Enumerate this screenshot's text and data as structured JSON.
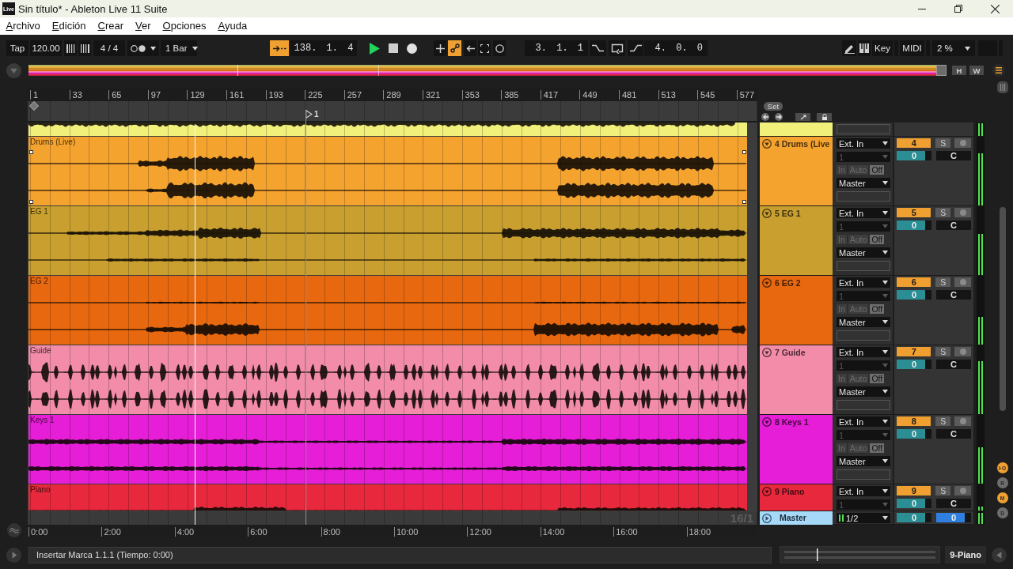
{
  "window": {
    "app_badge": "Live",
    "title": "Sin título* - Ableton Live 11 Suite"
  },
  "menu": [
    "Archivo",
    "Edición",
    "Crear",
    "Ver",
    "Opciones",
    "Ayuda"
  ],
  "control_bar": {
    "tap": "Tap",
    "tempo": "120.00",
    "signature": "4 / 4",
    "quantization": "1 Bar",
    "follow": {
      "on": true
    },
    "position": "138. 1. 4",
    "playing": true,
    "toggles": [
      {
        "kind": "overdub",
        "on": false
      },
      {
        "kind": "automation",
        "on": true
      },
      {
        "kind": "reenable",
        "on": false
      },
      {
        "kind": "capture",
        "on": false
      },
      {
        "kind": "session",
        "on": false
      }
    ],
    "loop_start": "3. 1. 1",
    "loop_length": "4. 0. 0",
    "key": "Key",
    "midi": "MIDI",
    "cpu": "2 %"
  },
  "overview": {
    "buttons": [
      "H",
      "W"
    ]
  },
  "arrangement": {
    "ruler": [
      "1",
      "33",
      "65",
      "97",
      "129",
      "161",
      "193",
      "225",
      "257",
      "289",
      "321",
      "353",
      "385",
      "417",
      "449",
      "481",
      "513",
      "545",
      "577"
    ],
    "set_button": "Set",
    "locator": "1",
    "tracks": [
      {
        "kind": "tail",
        "color": "#f1f07a",
        "meter": {
          "level": 0.95
        }
      },
      {
        "kind": "full",
        "color": "#f5a32f",
        "clip_name": "Drums (Live)",
        "clip_selected": true,
        "header": "4 Drums (Live",
        "expanded": true,
        "input": "Ext. In",
        "channel": {
          "label": "1",
          "disabled": true
        },
        "monitor": [
          {
            "label": "In",
            "selected": false
          },
          {
            "label": "Auto",
            "selected": false
          },
          {
            "label": "Off",
            "selected": true
          }
        ],
        "output": "Master",
        "number": "4",
        "active": true,
        "solo": {
          "label": "S",
          "on": false
        },
        "armed": false,
        "volume": {
          "reading": "0",
          "level": 0.82
        },
        "pan": "C",
        "meter": {
          "level": 0.76
        }
      },
      {
        "kind": "full",
        "color": "#c9a02f",
        "clip_name": "EG 1",
        "clip_selected": false,
        "header": "5 EG 1",
        "expanded": true,
        "input": "Ext. In",
        "channel": {
          "label": "1",
          "disabled": true
        },
        "monitor": [
          {
            "label": "In",
            "selected": false
          },
          {
            "label": "Auto",
            "selected": false
          },
          {
            "label": "Off",
            "selected": true
          }
        ],
        "output": "Master",
        "number": "5",
        "active": true,
        "solo": {
          "label": "S",
          "on": false
        },
        "armed": false,
        "volume": {
          "reading": "0",
          "level": 0.82
        },
        "pan": "C",
        "meter": {
          "level": 0.6
        }
      },
      {
        "kind": "full",
        "color": "#e8680f",
        "clip_name": "EG 2",
        "clip_selected": false,
        "header": "6 EG 2",
        "expanded": true,
        "input": "Ext. In",
        "channel": {
          "label": "1",
          "disabled": true
        },
        "monitor": [
          {
            "label": "In",
            "selected": false
          },
          {
            "label": "Auto",
            "selected": false
          },
          {
            "label": "Off",
            "selected": true
          }
        ],
        "output": "Master",
        "number": "6",
        "active": true,
        "solo": {
          "label": "S",
          "on": false
        },
        "armed": false,
        "volume": {
          "reading": "0",
          "level": 0.82
        },
        "pan": "C",
        "meter": {
          "level": 0.4
        }
      },
      {
        "kind": "full",
        "color": "#f28ca9",
        "clip_name": "Guide",
        "clip_selected": false,
        "header": "7 Guide",
        "expanded": true,
        "input": "Ext. In",
        "channel": {
          "label": "1",
          "disabled": true
        },
        "monitor": [
          {
            "label": "In",
            "selected": false
          },
          {
            "label": "Auto",
            "selected": false
          },
          {
            "label": "Off",
            "selected": true
          }
        ],
        "output": "Master",
        "number": "7",
        "active": true,
        "solo": {
          "label": "S",
          "on": false
        },
        "armed": false,
        "volume": {
          "reading": "0",
          "level": 0.82
        },
        "pan": "C",
        "meter": {
          "level": 0.77
        }
      },
      {
        "kind": "full",
        "color": "#e61ed7",
        "clip_name": "Keys 1",
        "clip_selected": false,
        "header": "8 Keys 1",
        "expanded": true,
        "input": "Ext. In",
        "channel": {
          "label": "1",
          "disabled": true
        },
        "monitor": [
          {
            "label": "In",
            "selected": false
          },
          {
            "label": "Auto",
            "selected": false
          },
          {
            "label": "Off",
            "selected": true
          }
        ],
        "output": "Master",
        "number": "8",
        "active": true,
        "solo": {
          "label": "S",
          "on": false
        },
        "armed": false,
        "volume": {
          "reading": "0",
          "level": 0.82
        },
        "pan": "C",
        "meter": {
          "level": 0.53
        }
      },
      {
        "kind": "short",
        "color": "#e8283c",
        "clip_name": "Piano",
        "clip_selected": false,
        "header": "9 Piano",
        "expanded": true,
        "input": "Ext. In",
        "channel": {
          "label": "1",
          "disabled": true
        },
        "number": "9",
        "active": true,
        "solo": {
          "label": "S",
          "on": false
        },
        "armed": false,
        "volume": {
          "reading": "0",
          "level": 0.82
        },
        "pan": "C",
        "meter": {
          "level": 0.15
        }
      }
    ],
    "master": {
      "header": "Master",
      "expanded": false,
      "output": "1/2",
      "volume": {
        "reading": "0",
        "level": 0.82
      },
      "cue": {
        "reading": "0",
        "level": 0.82
      },
      "meter": {
        "level": 0.9
      }
    },
    "grid_label": "16/1",
    "time_ruler": [
      "0:00",
      "2:00",
      "4:00",
      "6:00",
      "8:00",
      "10:00",
      "12:00",
      "14:00",
      "16:00",
      "18:00"
    ]
  },
  "side_buttons": [
    {
      "label": "I·O",
      "on": true
    },
    {
      "label": "R",
      "on": false
    },
    {
      "label": "M",
      "on": true
    },
    {
      "label": "D",
      "on": false
    }
  ],
  "status_bar": {
    "message": "Insertar Marca 1.1.1 (Tiempo: 0:00)",
    "selected_track": "9-Piano"
  }
}
